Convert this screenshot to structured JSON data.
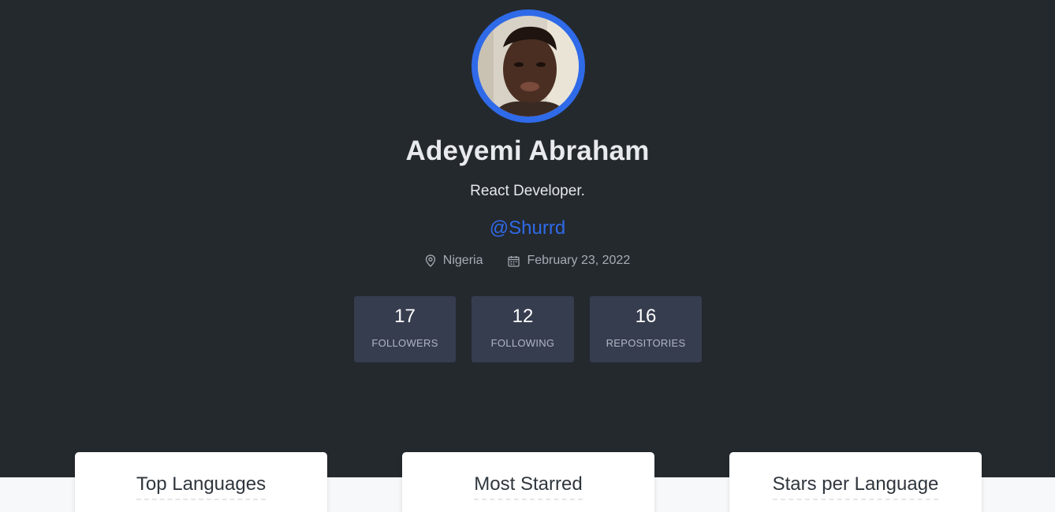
{
  "profile": {
    "name": "Adeyemi Abraham",
    "bio": "React Developer.",
    "handle": "@Shurrd",
    "location": "Nigeria",
    "joined": "February 23, 2022"
  },
  "stats": [
    {
      "value": "17",
      "label": "FOLLOWERS"
    },
    {
      "value": "12",
      "label": "FOLLOWING"
    },
    {
      "value": "16",
      "label": "REPOSITORIES"
    }
  ],
  "cards": [
    {
      "title": "Top Languages"
    },
    {
      "title": "Most Starred"
    },
    {
      "title": "Stars per Language"
    }
  ],
  "icons": {
    "location": "map-pin-icon",
    "calendar": "calendar-icon"
  },
  "colors": {
    "hero_bg": "#24292e",
    "accent": "#2f6ae8",
    "stat_bg": "#363d4f",
    "page_bg": "#f6f8fa"
  }
}
